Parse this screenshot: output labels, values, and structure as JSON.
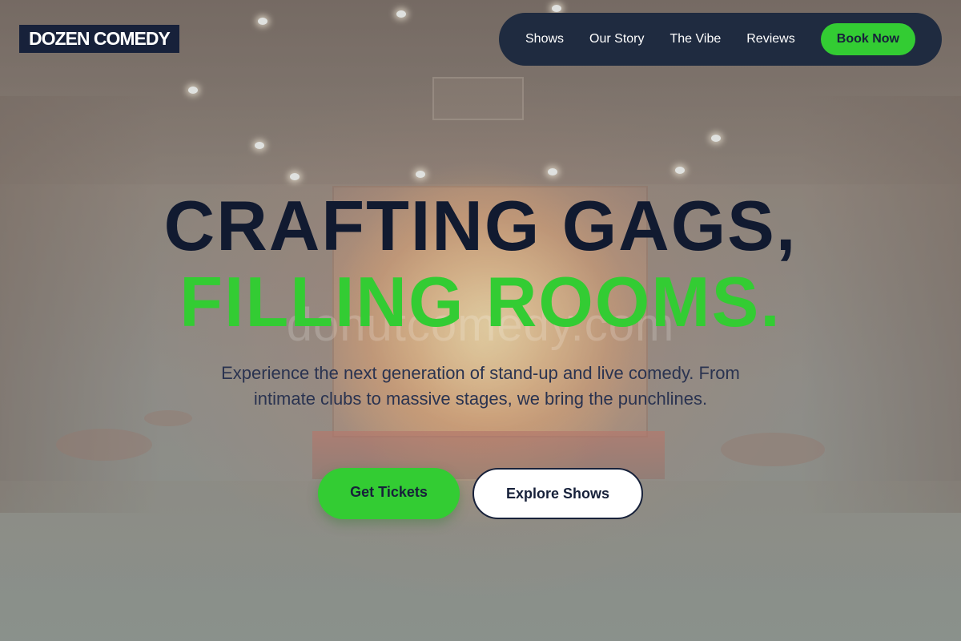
{
  "brand": {
    "logo_text": "DOZEN COMEDY"
  },
  "nav": {
    "items": [
      {
        "label": "Shows"
      },
      {
        "label": "Our Story"
      },
      {
        "label": "The Vibe"
      },
      {
        "label": "Reviews"
      }
    ],
    "cta_label": "Book Now"
  },
  "hero": {
    "headline_line1": "CRAFTING GAGS,",
    "headline_line2": "FILLING ROOMS.",
    "subtitle": "Experience the next generation of stand-up and live comedy. From intimate clubs to massive stages, we bring the punchlines.",
    "primary_button": "Get Tickets",
    "secondary_button": "Explore Shows",
    "background_watermark": "donutcomedy.com"
  },
  "colors": {
    "brand_navy": "#17213a",
    "accent_green": "#33cc33",
    "nav_background": "#1f2b40"
  }
}
